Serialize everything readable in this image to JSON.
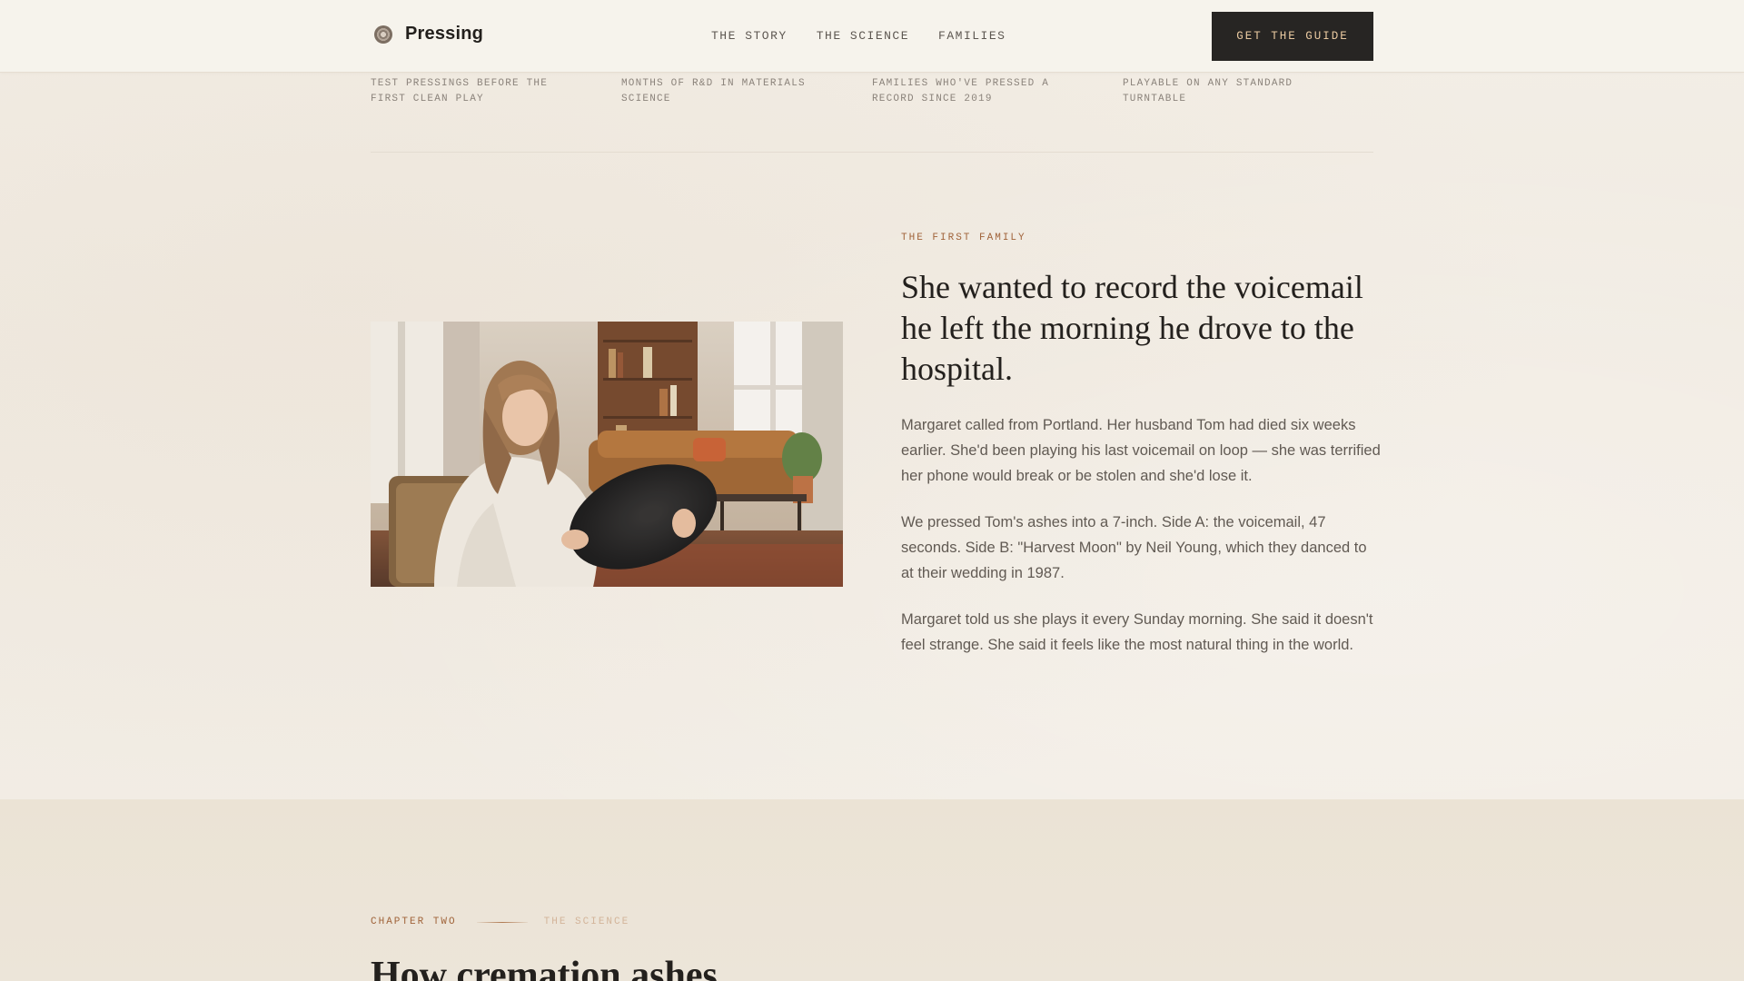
{
  "header": {
    "brand": "Pressing",
    "brand_icon": "vinyl-record-icon",
    "nav": [
      "THE STORY",
      "THE SCIENCE",
      "FAMILIES"
    ],
    "cta": "GET THE GUIDE"
  },
  "stats": [
    "TEST PRESSINGS BEFORE THE FIRST CLEAN PLAY",
    "MONTHS OF R&D IN MATERIALS SCIENCE",
    "FAMILIES WHO'VE PRESSED A RECORD SINCE 2019",
    "PLAYABLE ON ANY STANDARD TURNTABLE"
  ],
  "story": {
    "eyebrow": "THE FIRST FAMILY",
    "headline": "She wanted to record the voicemail he left the morning he drove to the hospital.",
    "paragraphs": [
      "Margaret called from Portland. Her husband Tom had died six weeks earlier. She'd been playing his last voicemail on loop — she was terrified her phone would break or be stolen and she'd lose it.",
      "We pressed Tom's ashes into a 7-inch. Side A: the voicemail, 47 seconds. Side B: \"Harvest Moon\" by Neil Young, which they danced to at their wedding in 1987.",
      "Margaret told us she plays it every Sunday morning. She said it doesn't feel strange. She said it feels like the most natural thing in the world."
    ]
  },
  "chapter": {
    "label": "CHAPTER TWO",
    "sub": "THE SCIENCE",
    "title": "How cremation ashes"
  },
  "colors": {
    "accent": "#a0633a",
    "cta_bg": "#272523",
    "cta_text": "#e9c9a0",
    "page_bg": "#f1ebe2"
  }
}
